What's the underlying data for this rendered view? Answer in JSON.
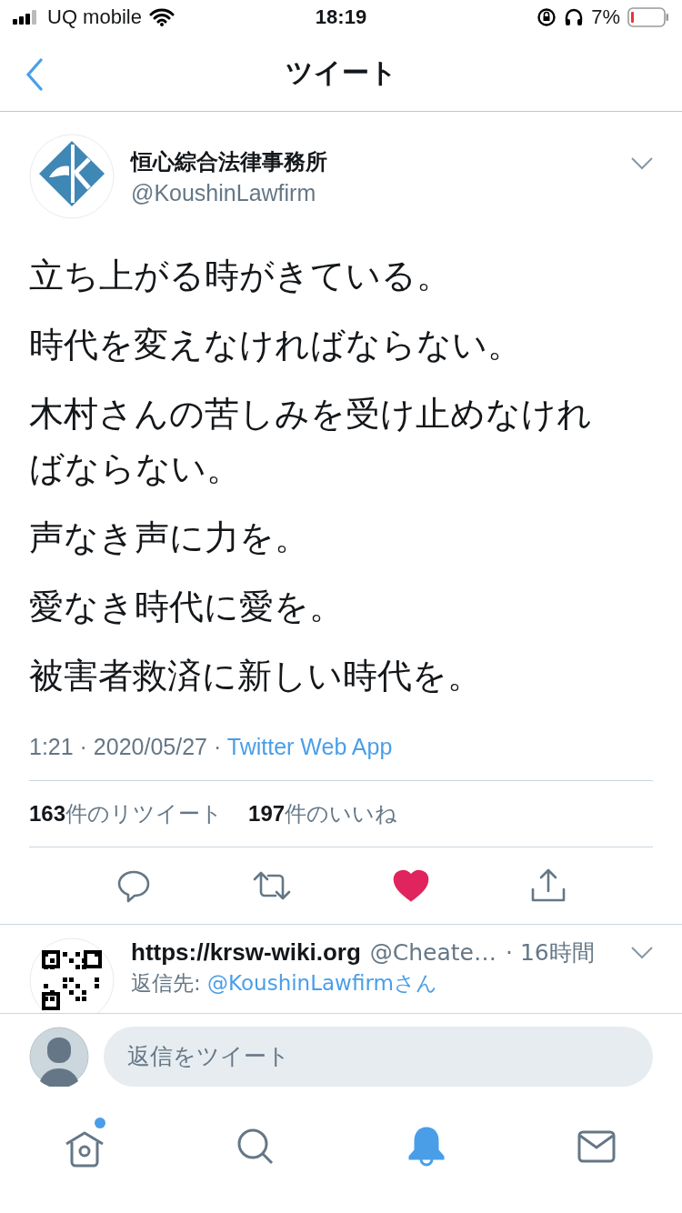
{
  "status_bar": {
    "carrier": "UQ mobile",
    "time": "18:19",
    "battery": "7%"
  },
  "nav": {
    "title": "ツイート"
  },
  "tweet": {
    "name": "恒心綜合法律事務所",
    "handle": "@KoushinLawfirm",
    "paragraphs": [
      "立ち上がる時がきている。",
      "時代を変えなければならない。",
      "木村さんの苦しみを受け止めなければならない。",
      "声なき声に力を。",
      "愛なき時代に愛を。",
      "被害者救済に新しい時代を。"
    ],
    "time": "1:21 · 2020/05/27 · ",
    "source": "Twitter Web App",
    "retweet_count": "163",
    "retweet_label": "件のリツイート",
    "like_count": "197",
    "like_label": "件のいいね",
    "liked": true
  },
  "reply": {
    "name": "https://krsw-wiki.org",
    "handle": "@Cheate…",
    "time": "· 16時間",
    "reply_to_label": "返信先: ",
    "reply_to": "@KoushinLawfirmさん"
  },
  "composer": {
    "placeholder": "返信をツイート"
  },
  "tab_bar": [
    {
      "kind": "home",
      "selected": false,
      "badge": true
    },
    {
      "kind": "search",
      "selected": false,
      "badge": false
    },
    {
      "kind": "notifications",
      "selected": true,
      "badge": false
    },
    {
      "kind": "messages",
      "selected": false,
      "badge": false
    }
  ]
}
